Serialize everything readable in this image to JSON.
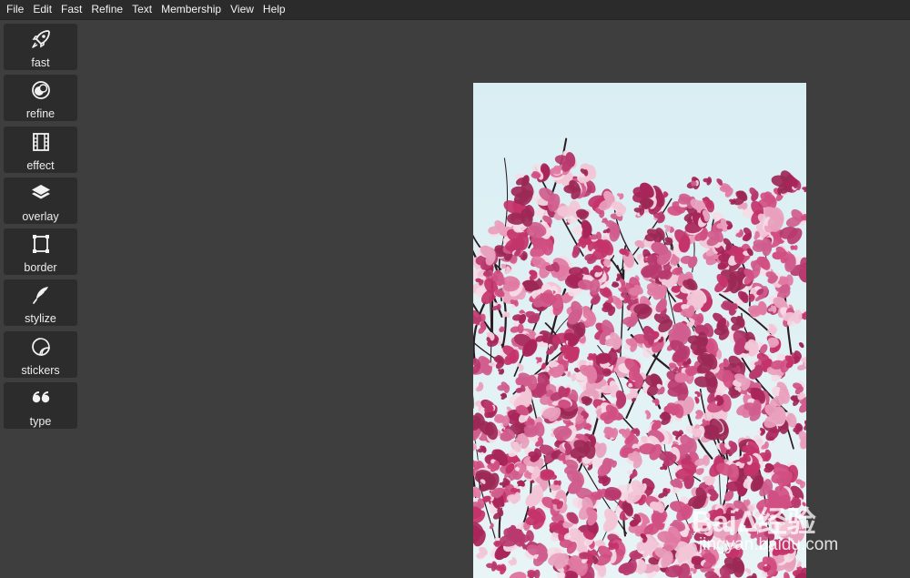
{
  "menubar": {
    "items": [
      "File",
      "Edit",
      "Fast",
      "Refine",
      "Text",
      "Membership",
      "View",
      "Help"
    ]
  },
  "toolbar": {
    "tools": [
      {
        "label": "fast",
        "icon": "rocket-icon"
      },
      {
        "label": "refine",
        "icon": "refine-icon"
      },
      {
        "label": "effect",
        "icon": "film-icon"
      },
      {
        "label": "overlay",
        "icon": "layers-icon"
      },
      {
        "label": "border",
        "icon": "frame-icon"
      },
      {
        "label": "stylize",
        "icon": "feather-icon"
      },
      {
        "label": "stickers",
        "icon": "sticker-icon"
      },
      {
        "label": "type",
        "icon": "quote-icon"
      }
    ]
  },
  "canvas": {
    "image": "magnolia-blossoms-photo"
  },
  "watermark": {
    "main": "BaiΔ经验",
    "url": "jingyan.baidu.com"
  },
  "colors": {
    "background": "#3e3e3e",
    "menubar": "#2b2b2b",
    "tool_bg": "#2c2c2c",
    "text": "#ededed",
    "sky": "#dbeff4",
    "blossom": "#c3336a"
  }
}
